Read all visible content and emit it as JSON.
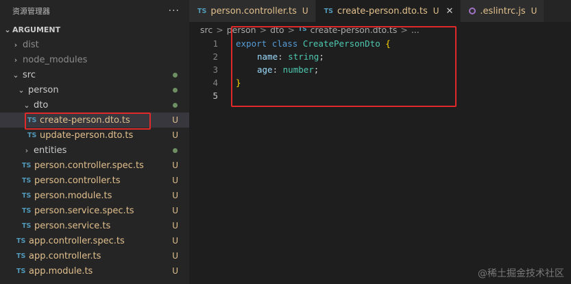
{
  "explorer": {
    "title": "资源管理器",
    "more": "···",
    "root": "ARGUMENT",
    "items": [
      {
        "label": "dist"
      },
      {
        "label": "node_modules"
      },
      {
        "label": "src"
      },
      {
        "label": "person"
      },
      {
        "label": "dto"
      },
      {
        "label": "create-person.dto.ts",
        "status": "U"
      },
      {
        "label": "update-person.dto.ts",
        "status": "U"
      },
      {
        "label": "entities"
      },
      {
        "label": "person.controller.spec.ts",
        "status": "U"
      },
      {
        "label": "person.controller.ts",
        "status": "U"
      },
      {
        "label": "person.module.ts",
        "status": "U"
      },
      {
        "label": "person.service.spec.ts",
        "status": "U"
      },
      {
        "label": "person.service.ts",
        "status": "U"
      },
      {
        "label": "app.controller.spec.ts",
        "status": "U"
      },
      {
        "label": "app.controller.ts",
        "status": "U"
      },
      {
        "label": "app.module.ts",
        "status": "U"
      }
    ],
    "ts_badge": "TS",
    "chevron_right": "›",
    "chevron_down": "⌄"
  },
  "tabs": [
    {
      "label": "person.controller.ts",
      "status": "U",
      "icon": "TS"
    },
    {
      "label": "create-person.dto.ts",
      "status": "U",
      "icon": "TS",
      "close": "✕"
    },
    {
      "label": ".eslintrc.js",
      "status": "U"
    }
  ],
  "breadcrumb": {
    "parts": [
      "src",
      "person",
      "dto",
      "create-person.dto.ts",
      "..."
    ],
    "ts_badge": "TS",
    "sep": ">"
  },
  "code": {
    "line_numbers": [
      "1",
      "2",
      "3",
      "4",
      "5"
    ],
    "l1": {
      "kw1": "export",
      "kw2": "class",
      "name": "CreatePersonDto",
      "brace": "{"
    },
    "l2": {
      "prop": "name",
      "colon": ":",
      "type": "string",
      "semi": ";"
    },
    "l3": {
      "prop": "age",
      "colon": ":",
      "type": "number",
      "semi": ";"
    },
    "l4": {
      "brace": "}"
    }
  },
  "watermark": "@稀土掘金技术社区",
  "colors": {
    "highlight_box": "#e02a2a",
    "untracked": "#e2c08d",
    "ts_icon": "#519aba"
  }
}
